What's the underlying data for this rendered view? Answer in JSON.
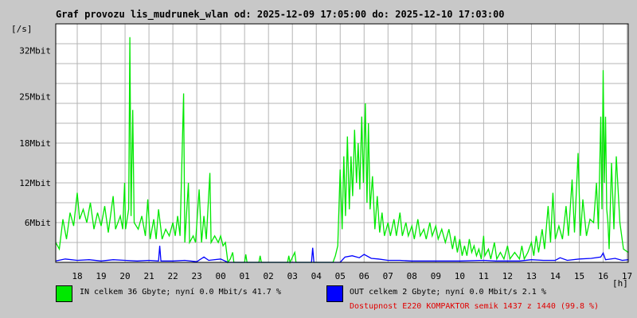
{
  "title": "Graf provozu lis_mudrunek_wlan od: 2025-12-09 17:05:00 do: 2025-12-10 17:03:00",
  "legend": {
    "in_text": "IN celkem 36 Gbyte; nyní   0.0 Mbit/s 41.7 %",
    "out_text": "OUT celkem 2 Gbyte; nyní   0.0 Mbit/s 2.1 %",
    "availability": "Dostupnost E220 KOMPAKTOR semik 1437 z 1440 (99.8 %)"
  },
  "colors": {
    "background": "#c8c8c8",
    "plot_bg": "#ffffff",
    "grid": "#b4b4b4",
    "in": "#00e800",
    "out": "#0000ff",
    "availability": "#e00000"
  },
  "chart_data": {
    "type": "line",
    "title": "Graf provozu lis_mudrunek_wlan od: 2025-12-09 17:05:00 do: 2025-12-10 17:03:00",
    "ylabel": "[/s]",
    "xlabel": "[h]",
    "x_tick_labels": [
      "18",
      "19",
      "20",
      "21",
      "22",
      "23",
      "00",
      "01",
      "02",
      "03",
      "04",
      "05",
      "06",
      "07",
      "08",
      "09",
      "10",
      "11",
      "12",
      "13",
      "14",
      "15",
      "16",
      "17"
    ],
    "y_ticks": [
      {
        "value": 6,
        "label": "6Mbit"
      },
      {
        "value": 12,
        "label": "12Mbit"
      },
      {
        "value": 18,
        "label": "18Mbit"
      },
      {
        "value": 25,
        "label": "25Mbit"
      },
      {
        "value": 32,
        "label": "32Mbit"
      }
    ],
    "ylim": [
      0,
      36
    ],
    "xlim": [
      17.1,
      41.05
    ],
    "grid": true,
    "series": [
      {
        "name": "IN",
        "color": "#00e800",
        "points": [
          [
            17.1,
            3.0
          ],
          [
            17.25,
            2.0
          ],
          [
            17.4,
            6.5
          ],
          [
            17.55,
            3.5
          ],
          [
            17.7,
            7.5
          ],
          [
            17.85,
            5.5
          ],
          [
            18.0,
            10.5
          ],
          [
            18.1,
            6.5
          ],
          [
            18.25,
            8.0
          ],
          [
            18.4,
            6.0
          ],
          [
            18.55,
            9.0
          ],
          [
            18.7,
            5.0
          ],
          [
            18.85,
            7.5
          ],
          [
            19.0,
            5.5
          ],
          [
            19.15,
            8.5
          ],
          [
            19.3,
            4.5
          ],
          [
            19.5,
            10.0
          ],
          [
            19.6,
            5.0
          ],
          [
            19.8,
            7.0
          ],
          [
            19.9,
            5.0
          ],
          [
            19.98,
            12.0
          ],
          [
            20.02,
            5.0
          ],
          [
            20.15,
            8.0
          ],
          [
            20.2,
            34.0
          ],
          [
            20.25,
            7.0
          ],
          [
            20.32,
            23.0
          ],
          [
            20.38,
            6.0
          ],
          [
            20.55,
            5.0
          ],
          [
            20.7,
            7.0
          ],
          [
            20.85,
            4.0
          ],
          [
            20.95,
            9.5
          ],
          [
            21.05,
            3.5
          ],
          [
            21.2,
            6.5
          ],
          [
            21.3,
            3.5
          ],
          [
            21.4,
            8.0
          ],
          [
            21.55,
            3.5
          ],
          [
            21.7,
            5.0
          ],
          [
            21.85,
            4.0
          ],
          [
            22.0,
            6.0
          ],
          [
            22.1,
            4.0
          ],
          [
            22.2,
            7.0
          ],
          [
            22.3,
            4.0
          ],
          [
            22.45,
            25.5
          ],
          [
            22.5,
            3.0
          ],
          [
            22.65,
            12.0
          ],
          [
            22.7,
            3.0
          ],
          [
            22.85,
            4.0
          ],
          [
            22.95,
            3.0
          ],
          [
            23.1,
            11.0
          ],
          [
            23.2,
            3.0
          ],
          [
            23.3,
            7.0
          ],
          [
            23.4,
            3.5
          ],
          [
            23.55,
            13.5
          ],
          [
            23.6,
            3.0
          ],
          [
            23.75,
            4.0
          ],
          [
            23.9,
            3.0
          ],
          [
            24.0,
            4.0
          ],
          [
            24.1,
            2.5
          ],
          [
            24.2,
            3.0
          ],
          [
            24.3,
            0.0
          ],
          [
            24.4,
            0.5
          ],
          [
            24.5,
            1.5
          ],
          [
            24.55,
            0.0
          ],
          [
            25.0,
            0.0
          ],
          [
            25.05,
            1.2
          ],
          [
            25.1,
            0.0
          ],
          [
            25.6,
            0.0
          ],
          [
            25.65,
            1.0
          ],
          [
            25.7,
            0.0
          ],
          [
            26.8,
            0.0
          ],
          [
            26.85,
            1.0
          ],
          [
            26.9,
            0.0
          ],
          [
            27.1,
            1.5
          ],
          [
            27.15,
            0.0
          ],
          [
            28.7,
            0.0
          ],
          [
            28.8,
            1.0
          ],
          [
            28.9,
            2.5
          ],
          [
            29.0,
            14.0
          ],
          [
            29.08,
            5.0
          ],
          [
            29.15,
            16.0
          ],
          [
            29.22,
            7.0
          ],
          [
            29.3,
            19.0
          ],
          [
            29.38,
            8.0
          ],
          [
            29.45,
            16.0
          ],
          [
            29.52,
            10.0
          ],
          [
            29.6,
            20.0
          ],
          [
            29.68,
            12.0
          ],
          [
            29.75,
            18.0
          ],
          [
            29.82,
            11.0
          ],
          [
            29.9,
            22.0
          ],
          [
            29.97,
            12.0
          ],
          [
            30.05,
            24.0
          ],
          [
            30.12,
            9.0
          ],
          [
            30.18,
            21.0
          ],
          [
            30.25,
            8.0
          ],
          [
            30.35,
            13.0
          ],
          [
            30.45,
            5.0
          ],
          [
            30.55,
            10.0
          ],
          [
            30.65,
            4.5
          ],
          [
            30.75,
            7.5
          ],
          [
            30.85,
            4.0
          ],
          [
            31.0,
            6.0
          ],
          [
            31.1,
            4.0
          ],
          [
            31.25,
            6.5
          ],
          [
            31.35,
            4.0
          ],
          [
            31.5,
            7.5
          ],
          [
            31.6,
            4.0
          ],
          [
            31.75,
            6.0
          ],
          [
            31.85,
            4.0
          ],
          [
            32.0,
            5.5
          ],
          [
            32.1,
            3.5
          ],
          [
            32.25,
            6.5
          ],
          [
            32.35,
            4.0
          ],
          [
            32.5,
            5.0
          ],
          [
            32.6,
            3.5
          ],
          [
            32.75,
            6.0
          ],
          [
            32.85,
            4.0
          ],
          [
            33.0,
            5.5
          ],
          [
            33.1,
            3.5
          ],
          [
            33.25,
            5.0
          ],
          [
            33.4,
            3.0
          ],
          [
            33.55,
            5.0
          ],
          [
            33.7,
            2.0
          ],
          [
            33.8,
            4.0
          ],
          [
            33.9,
            1.5
          ],
          [
            34.0,
            3.5
          ],
          [
            34.1,
            1.0
          ],
          [
            34.2,
            2.5
          ],
          [
            34.3,
            1.0
          ],
          [
            34.4,
            3.5
          ],
          [
            34.5,
            1.5
          ],
          [
            34.6,
            2.5
          ],
          [
            34.7,
            1.0
          ],
          [
            34.8,
            2.0
          ],
          [
            34.9,
            0.5
          ],
          [
            35.0,
            4.0
          ],
          [
            35.05,
            1.0
          ],
          [
            35.2,
            2.0
          ],
          [
            35.3,
            0.5
          ],
          [
            35.45,
            3.0
          ],
          [
            35.55,
            0.5
          ],
          [
            35.7,
            1.5
          ],
          [
            35.85,
            0.5
          ],
          [
            36.0,
            2.5
          ],
          [
            36.1,
            0.5
          ],
          [
            36.3,
            1.5
          ],
          [
            36.5,
            0.5
          ],
          [
            36.6,
            2.5
          ],
          [
            36.7,
            0.5
          ],
          [
            36.85,
            1.5
          ],
          [
            37.0,
            3.0
          ],
          [
            37.1,
            1.0
          ],
          [
            37.2,
            4.0
          ],
          [
            37.3,
            1.5
          ],
          [
            37.45,
            5.0
          ],
          [
            37.55,
            2.0
          ],
          [
            37.7,
            8.5
          ],
          [
            37.8,
            3.0
          ],
          [
            37.9,
            10.5
          ],
          [
            38.0,
            3.5
          ],
          [
            38.15,
            5.5
          ],
          [
            38.3,
            3.5
          ],
          [
            38.45,
            8.5
          ],
          [
            38.55,
            4.0
          ],
          [
            38.7,
            12.5
          ],
          [
            38.8,
            4.5
          ],
          [
            38.95,
            16.5
          ],
          [
            39.05,
            4.0
          ],
          [
            39.15,
            9.5
          ],
          [
            39.3,
            4.0
          ],
          [
            39.45,
            6.5
          ],
          [
            39.6,
            6.0
          ],
          [
            39.72,
            12.0
          ],
          [
            39.8,
            5.0
          ],
          [
            39.9,
            22.0
          ],
          [
            39.95,
            8.0
          ],
          [
            40.0,
            29.0
          ],
          [
            40.05,
            12.0
          ],
          [
            40.1,
            22.0
          ],
          [
            40.15,
            8.0
          ],
          [
            40.2,
            6.0
          ],
          [
            40.25,
            2.0
          ],
          [
            40.35,
            15.0
          ],
          [
            40.45,
            5.0
          ],
          [
            40.55,
            16.0
          ],
          [
            40.7,
            6.0
          ],
          [
            40.85,
            2.0
          ],
          [
            41.05,
            1.5
          ]
        ]
      },
      {
        "name": "OUT",
        "color": "#0000ff",
        "points": [
          [
            17.1,
            0.2
          ],
          [
            17.5,
            0.5
          ],
          [
            18.0,
            0.3
          ],
          [
            18.5,
            0.4
          ],
          [
            19.0,
            0.2
          ],
          [
            19.5,
            0.4
          ],
          [
            20.0,
            0.3
          ],
          [
            20.5,
            0.2
          ],
          [
            21.0,
            0.3
          ],
          [
            21.4,
            0.2
          ],
          [
            21.45,
            2.5
          ],
          [
            21.5,
            0.2
          ],
          [
            22.0,
            0.2
          ],
          [
            22.5,
            0.3
          ],
          [
            23.0,
            0.1
          ],
          [
            23.3,
            0.8
          ],
          [
            23.5,
            0.3
          ],
          [
            24.0,
            0.5
          ],
          [
            24.3,
            0.0
          ],
          [
            27.8,
            0.0
          ],
          [
            27.85,
            2.2
          ],
          [
            27.9,
            0.0
          ],
          [
            29.0,
            0.0
          ],
          [
            29.2,
            0.8
          ],
          [
            29.5,
            1.0
          ],
          [
            29.8,
            0.7
          ],
          [
            30.0,
            1.2
          ],
          [
            30.3,
            0.6
          ],
          [
            30.6,
            0.5
          ],
          [
            31.0,
            0.3
          ],
          [
            31.5,
            0.3
          ],
          [
            32.0,
            0.2
          ],
          [
            33.0,
            0.2
          ],
          [
            34.0,
            0.2
          ],
          [
            35.0,
            0.3
          ],
          [
            35.5,
            0.2
          ],
          [
            36.0,
            0.2
          ],
          [
            36.5,
            0.2
          ],
          [
            37.0,
            0.4
          ],
          [
            37.5,
            0.3
          ],
          [
            38.0,
            0.3
          ],
          [
            38.2,
            0.7
          ],
          [
            38.5,
            0.3
          ],
          [
            39.0,
            0.5
          ],
          [
            39.5,
            0.6
          ],
          [
            39.9,
            0.8
          ],
          [
            40.0,
            1.4
          ],
          [
            40.1,
            0.4
          ],
          [
            40.5,
            0.6
          ],
          [
            40.8,
            0.3
          ],
          [
            41.05,
            0.4
          ]
        ]
      }
    ]
  }
}
